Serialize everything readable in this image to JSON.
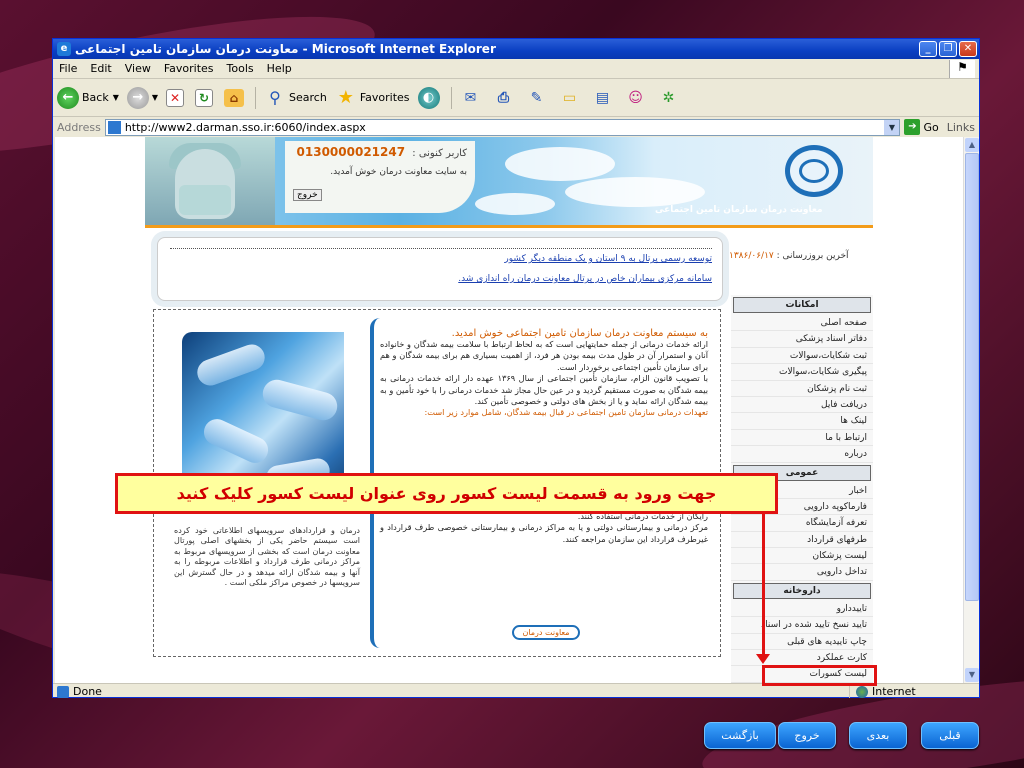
{
  "browser": {
    "title": "معاونت درمان سازمان تامین اجتماعی - Microsoft Internet Explorer",
    "menu": [
      "File",
      "Edit",
      "View",
      "Favorites",
      "Tools",
      "Help"
    ],
    "toolbar": {
      "back": "Back",
      "search": "Search",
      "favorites": "Favorites"
    },
    "address_label": "Address",
    "url": "http://www2.darman.sso.ir:6060/index.aspx",
    "go": "Go",
    "links": "Links",
    "status_left": "Done",
    "status_zone": "Internet"
  },
  "header": {
    "user_label": "کاربر کنونی :",
    "user_id": "0130000021247",
    "welcome": "به سایت معاونت درمان خوش آمدید.",
    "logout": "خروج",
    "logo_text": "معاونت درمان سازمان تامین اجتماعی"
  },
  "news": {
    "last_update": "آخرین بروزرسانی : ",
    "last_update_date": "۱۳۸۶/۰۶/۱۷",
    "items": [
      "توسعه رسمی پرتال به ۹ استان و یک منطقه دیگر کشور",
      "سامانه مرکزی بیماران خاص در پرتال معاونت درمان راه اندازی شد."
    ]
  },
  "main": {
    "heading": "به سیستم معاونت درمان سازمان تامین اجتماعی خوش امدید.",
    "p1": "ارائه خدمات درمانی از جمله حمایتهایی است که به لحاظ ارتباط با سلامت بیمه شدگان و خانواده آنان و استمرار آن در طول مدت بیمه بودن هر فرد، از اهمیت بسیاری هم برای بیمه شدگان و هم برای سازمان تأمین اجتماعی برخوردار است.",
    "p2": "با تصویب قانون الزام، سازمان تأمین اجتماعی از سال ۱۳۶۹ عهده دار ارائه خدمات درمانی به بیمه شدگان به صورت مستقیم گردید و در عین حال مجاز شد خدمات درمانی را با خود تأمین و به بیمه شدگان ارائه نماید و یا از بخش های دولتی و خصوصی تأمین کند.",
    "orange": "تعهدات درمانی سازمان تامین اجتماعی در قبال بیمه شدگان، شامل موارد زیر است:",
    "p3": "خدمات درمانی سازمان تأمین اجتماعی از طریق دفترچه های خدمات درمانی به بیمه شدگان تحت پوشش این سازمان و افراد تحت تکفل آنان ارائه می شود. بیمه شده و افراد خانواده وی، با این دفترچه ها می توانند به مراکز درمانی و بیمارستانی اختصاصی سازمان تامین اجتماعی و به طور رایگان از خدمات درمانی استفاده کنند.",
    "p4": "مرکز درمانی و بیمارستانی دولتی و یا به مراکز درمانی و بیمارستانی خصوصی طرف قرارداد و غیرطرف قرارداد این سازمان مراجعه کنند.",
    "more": "معاونت درمان",
    "left_text": "درمان و قراردادهای سرویسهای اطلاعاتی خود کرده است سیستم حاضر یکی از بخشهای اصلی پورتال معاونت درمان است که بخشی از سرویسهای مربوط به مراکز درمانی طرف قرارداد و اطلاعات مربوطه را به آنها و بیمه شدگان ارائه میدهد و در حال گسترش این سرویسها در خصوص مراکز ملکی است ."
  },
  "sidebar": {
    "sections": [
      {
        "title": "امکانات",
        "items": [
          "صفحه اصلی",
          "دفاتر اسناد پزشکی",
          "ثبت شکایات،سوالات",
          "پیگیری شکایات،سوالات",
          "ثبت نام پزشکان",
          "دریافت فایل",
          "لینک ها",
          "ارتباط با ما",
          "درباره"
        ]
      },
      {
        "title": "عمومی",
        "items": [
          "اخبار",
          "فارماکوپه دارویی",
          "تعرفه آزمایشگاه",
          "طرفهای قرارداد",
          "لیست پزشکان",
          "تداخل دارویی"
        ]
      },
      {
        "title": "داروخانه",
        "items": [
          "تاییددارو",
          "تایید نسخ تایید شده در اسناد",
          "چاپ تاییدیه های قبلی",
          "کارت عملکرد",
          "لیست کسورات"
        ]
      }
    ]
  },
  "callout": {
    "text": "جهت ورود به قسمت لیست کسور روی عنوان لیست کسور کلیک کنید"
  },
  "slide_nav": {
    "back": "بازگشت",
    "exit": "خروج",
    "next": "بعدی",
    "prev": "قبلی"
  },
  "colors": {
    "accent_red": "#e01212",
    "callout_bg": "#ffff9e",
    "ie_blue": "#0a3fc2",
    "nav_blue": "#0a64d2"
  }
}
